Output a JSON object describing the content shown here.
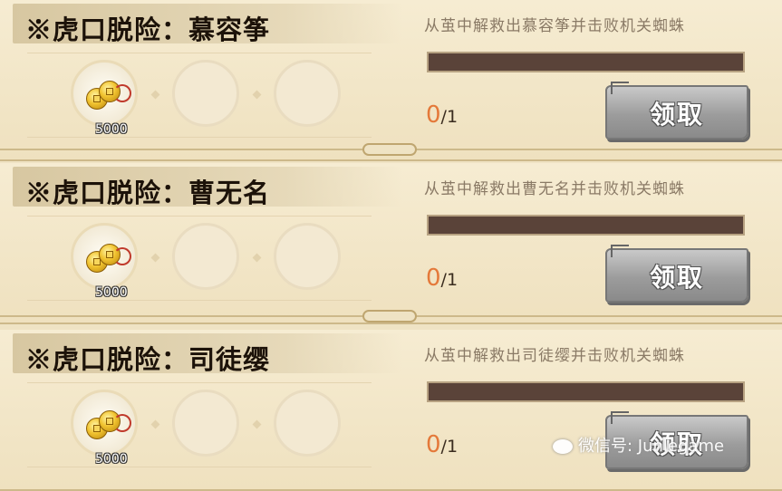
{
  "quests": [
    {
      "title": "※虎口脱险：慕容筝",
      "description": "从茧中解救出慕容筝并击败机关蜘蛛",
      "reward_amount": "5000",
      "progress_current": "0",
      "progress_total": "/1",
      "progress_fraction": 0,
      "claim_label": "领取"
    },
    {
      "title": "※虎口脱险：曹无名",
      "description": "从茧中解救出曹无名并击败机关蜘蛛",
      "reward_amount": "5000",
      "progress_current": "0",
      "progress_total": "/1",
      "progress_fraction": 0,
      "claim_label": "领取"
    },
    {
      "title": "※虎口脱险：司徒缨",
      "description": "从茧中解救出司徒缨并击败机关蜘蛛",
      "reward_amount": "5000",
      "progress_current": "0",
      "progress_total": "/1",
      "progress_fraction": 0,
      "claim_label": "领取"
    }
  ],
  "watermark": {
    "text": "微信号: Junlegame",
    "icon": "wechat-icon"
  },
  "colors": {
    "background": "#efe3c4",
    "progress_track": "#5a4339",
    "progress_current": "#e4793a",
    "button_gray": "#9c9c9c"
  }
}
